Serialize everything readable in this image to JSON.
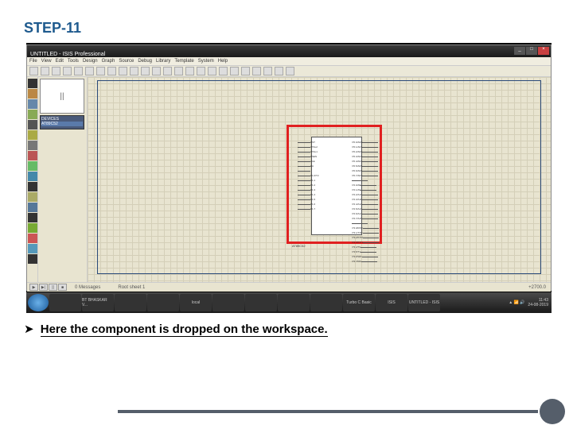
{
  "slide": {
    "step_title": "STEP-11",
    "bullet_symbol": "➤",
    "caption": "Here the component is dropped on the workspace."
  },
  "app": {
    "title": "UNTITLED - ISIS Professional",
    "menu_items": [
      "File",
      "View",
      "Edit",
      "Tools",
      "Design",
      "Graph",
      "Source",
      "Debug",
      "Library",
      "Template",
      "System",
      "Help"
    ],
    "preview_marker": "||",
    "devices_header": "DEVICES",
    "devices": [
      "AT89C52"
    ],
    "status": {
      "messages_label": "0 Messages",
      "root_sheet": "Root sheet 1",
      "coords": "+2700.0"
    },
    "play_labels": [
      "▶",
      "▶|",
      "||",
      "■"
    ],
    "chip_label": "AT89C52",
    "pins_left": [
      "RST",
      "XTAL2",
      "XTAL1",
      "PSEN",
      "ALE",
      "EA",
      "",
      "P1.0/T2",
      "P1.1",
      "P1.2",
      "P1.3",
      "P1.4",
      "P1.5",
      "P1.6",
      "P1.7"
    ],
    "pins_right": [
      "P0.0/AD0",
      "P0.1/AD1",
      "P0.2/AD2",
      "P0.3/AD3",
      "P0.4/AD4",
      "P0.5/AD5",
      "P0.6/AD6",
      "P0.7/AD7",
      "",
      "P2.0/A8",
      "P2.1/A9",
      "P2.2/A10",
      "P2.3/A11",
      "P2.4/A12",
      "P2.5/A13",
      "P2.6/A14",
      "P2.7/A15",
      "",
      "P3.0/RXD",
      "P3.1/TXD",
      "P3.2/INT0",
      "P3.3/INT1",
      "P3.4/T0",
      "P3.5/T1",
      "P3.6/WR",
      "P3.7/RD"
    ]
  },
  "taskbar": {
    "items": [
      "",
      "BT BHASKAR V...",
      "",
      "",
      "local",
      "",
      "",
      "",
      "",
      "Turbo C Basic",
      "ISIS",
      "UNTITLED - ISIS"
    ],
    "time": "11:43",
    "date": "24-08-2019"
  },
  "icon_colors": [
    "#333",
    "#b84",
    "#68a",
    "#8a5",
    "#555",
    "#aa4",
    "#777",
    "#b55",
    "#6b6",
    "#48a",
    "#333",
    "#aa6",
    "#579",
    "#333",
    "#7a3",
    "#c55",
    "#59b",
    "#333"
  ]
}
